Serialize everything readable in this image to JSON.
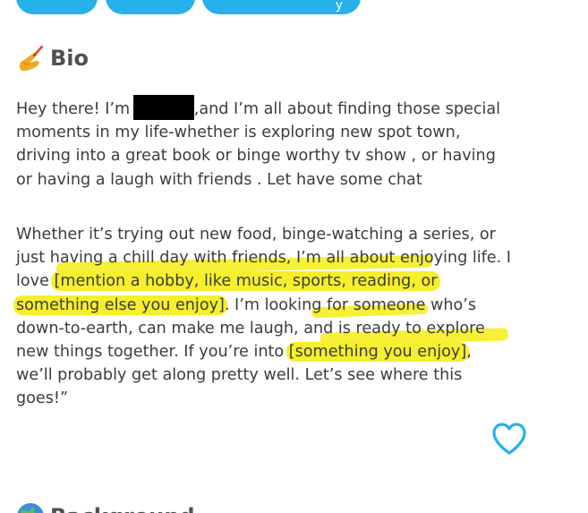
{
  "top_chips": [
    {
      "label": ""
    },
    {
      "label": ""
    },
    {
      "label": "y"
    }
  ],
  "bio": {
    "title": "Bio",
    "icon": "writing-hand-icon",
    "paragraph1": {
      "line1_before": "Hey there! I’m ",
      "line1_after": ",and I’m all about finding those special",
      "line2": "moments in my life-whether is exploring new spot town,",
      "line3": "driving into a great book or binge worthy tv show , or having",
      "line4": "or having a laugh with friends . Let have some chat"
    },
    "paragraph2": {
      "line1": "Whether it’s trying out new food, binge-watching a series, or",
      "line2": "just having a chill day with friends, I’m all about enjoying life. I",
      "line3_before": "love ",
      "line3_hl": "[mention a hobby, like music, sports, reading, or",
      "line4_hl": "something else you enjoy]",
      "line4_after": ". I’m looking for someone who’s",
      "line5": "down-to-earth, can make me laugh, and is ready to explore",
      "line6_before": "new things together. If you’re into ",
      "line6_hl": "[something you enjoy]",
      "line6_after": ",",
      "line7": "we’ll probably get along pretty well. Let’s see where this",
      "line8": "goes!”"
    },
    "like_icon": "heart-icon"
  },
  "background": {
    "title": "Background",
    "icon": "globe-icon"
  },
  "colors": {
    "chip": "#25b1ea",
    "highlight": "#f6ef2c",
    "heart": "#25b1ea",
    "text": "#3c3c3c"
  }
}
